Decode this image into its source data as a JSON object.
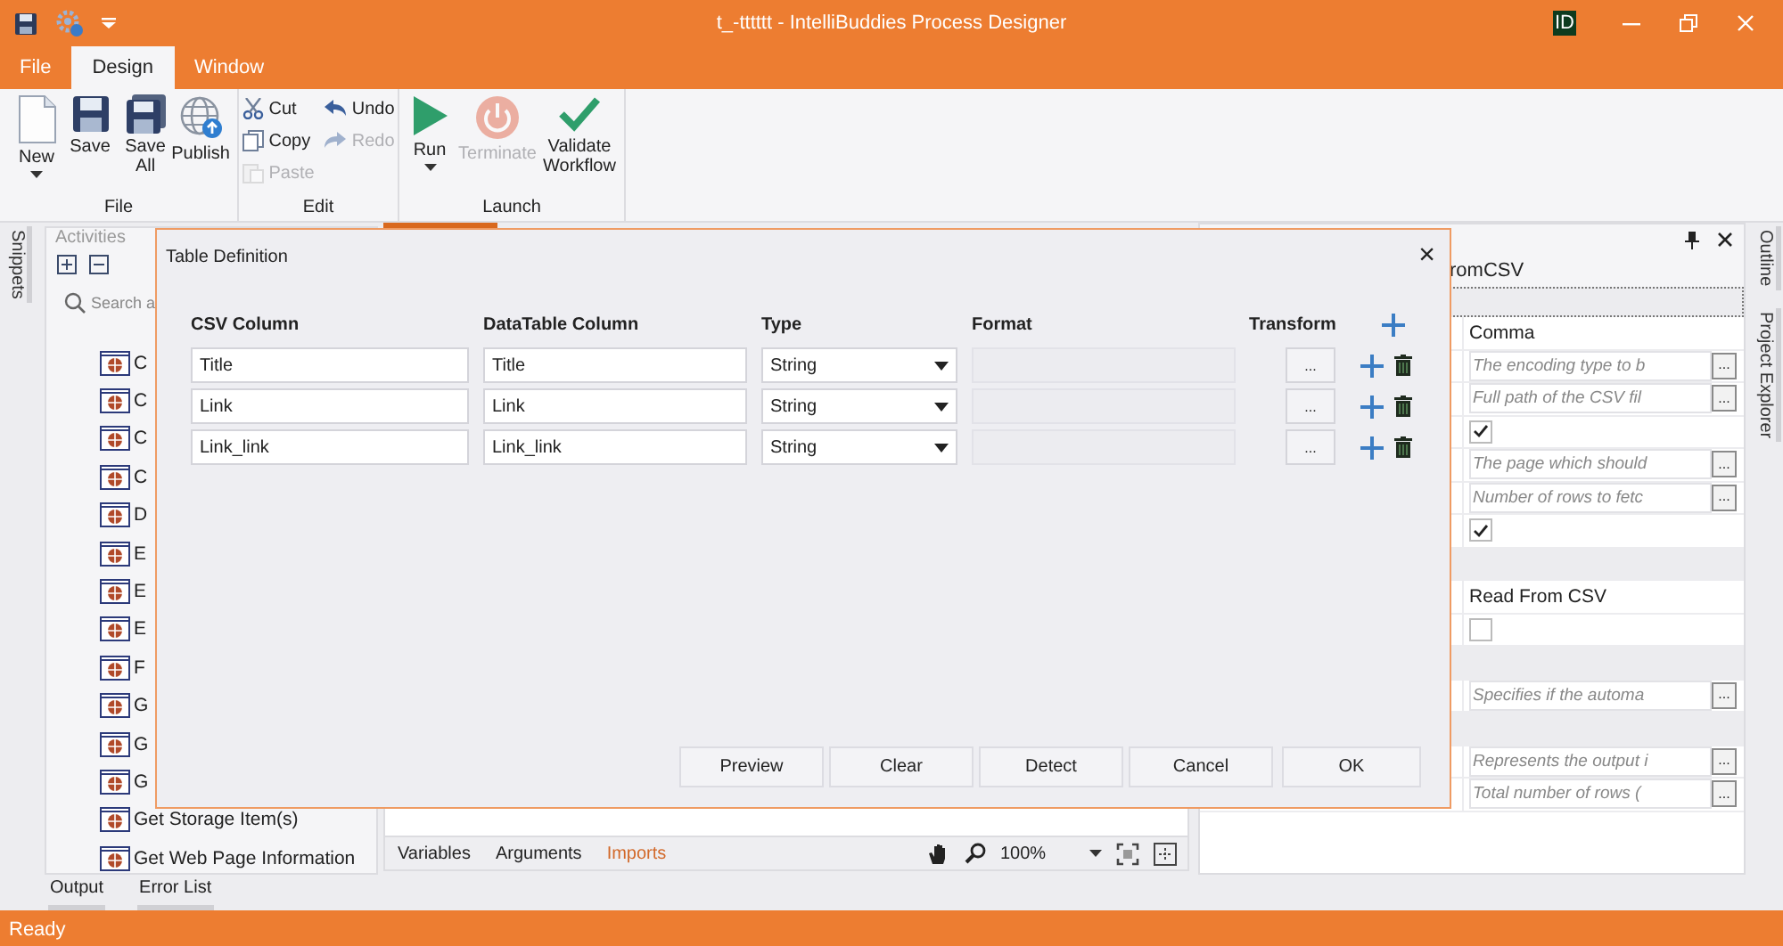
{
  "window": {
    "title": "t_-tttttt - IntelliBuddies Process Designer",
    "user_badge": "ID"
  },
  "menu_tabs": [
    {
      "label": "File",
      "selected": false
    },
    {
      "label": "Design",
      "selected": true
    },
    {
      "label": "Window",
      "selected": false
    }
  ],
  "ribbon": {
    "file_group": "File",
    "edit_group": "Edit",
    "launch_group": "Launch",
    "new": {
      "label": "New",
      "disabled": false
    },
    "save": {
      "label": "Save",
      "disabled": false
    },
    "save_all": {
      "label": "Save All",
      "disabled": false
    },
    "publish": {
      "label": "Publish",
      "disabled": false
    },
    "cut": {
      "label": "Cut",
      "disabled": false
    },
    "copy": {
      "label": "Copy",
      "disabled": false
    },
    "paste": {
      "label": "Paste",
      "disabled": true
    },
    "undo": {
      "label": "Undo",
      "disabled": false
    },
    "redo": {
      "label": "Redo",
      "disabled": true
    },
    "run": {
      "label": "Run",
      "disabled": false
    },
    "terminate": {
      "label": "Terminate",
      "disabled": true
    },
    "validate": {
      "label": "Validate Workflow",
      "disabled": false
    }
  },
  "left_strip": [
    "Snippets"
  ],
  "activities": {
    "title": "Activities",
    "search": {
      "placeholder": "Search a"
    },
    "items": [
      "C",
      "C",
      "C",
      "C",
      "D",
      "E",
      "E",
      "E",
      "F",
      "G",
      "G",
      "G",
      "Get Storage Item(s)",
      "Get Web Page Information"
    ]
  },
  "designer": {
    "tabs": [
      {
        "label": "Variables",
        "highlighted": false
      },
      {
        "label": "Arguments",
        "highlighted": false
      },
      {
        "label": "Imports",
        "highlighted": true
      }
    ],
    "zoom": "100%"
  },
  "properties": {
    "title": "romCSV",
    "rows": [
      {
        "kind": "category"
      },
      {
        "kind": "text",
        "value": "Comma"
      },
      {
        "kind": "input",
        "placeholder": "The encoding type to b",
        "button": "..."
      },
      {
        "kind": "input",
        "placeholder": "Full path of the CSV fil",
        "button": "..."
      },
      {
        "kind": "check",
        "checked": true
      },
      {
        "kind": "input",
        "placeholder": "The page which should",
        "button": "..."
      },
      {
        "kind": "input",
        "placeholder": "Number of rows to fetc",
        "button": "..."
      },
      {
        "kind": "check",
        "checked": true
      },
      {
        "kind": "category"
      },
      {
        "kind": "text",
        "value": "Read From CSV"
      },
      {
        "kind": "check",
        "checked": false
      },
      {
        "kind": "category"
      },
      {
        "kind": "input",
        "placeholder": "Specifies if the automa",
        "button": "..."
      },
      {
        "kind": "category"
      },
      {
        "kind": "input",
        "placeholder": "Represents the output i",
        "button": "..."
      },
      {
        "kind": "input",
        "placeholder": "Total number of rows (",
        "button": "..."
      }
    ]
  },
  "right_strip": [
    "Outline",
    "Project Explorer"
  ],
  "dialog": {
    "title": "Table Definition",
    "close": "×",
    "columns": [
      "CSV Column",
      "DataTable Column",
      "Type",
      "Format",
      "Transform"
    ],
    "rows": [
      {
        "csv": "Title",
        "datatable": "Title",
        "type": "String",
        "format_disabled": true,
        "transform": "..."
      },
      {
        "csv": "Link",
        "datatable": "Link",
        "type": "String",
        "format_disabled": true,
        "transform": "..."
      },
      {
        "csv": "Link_link",
        "datatable": "Link_link",
        "type": "String",
        "format_disabled": true,
        "transform": "..."
      }
    ],
    "buttons": [
      "Preview",
      "Clear",
      "Detect",
      "Cancel",
      "OK"
    ]
  },
  "bottom_tabs": [
    "Output",
    "Error List"
  ],
  "status_bar": "Ready"
}
